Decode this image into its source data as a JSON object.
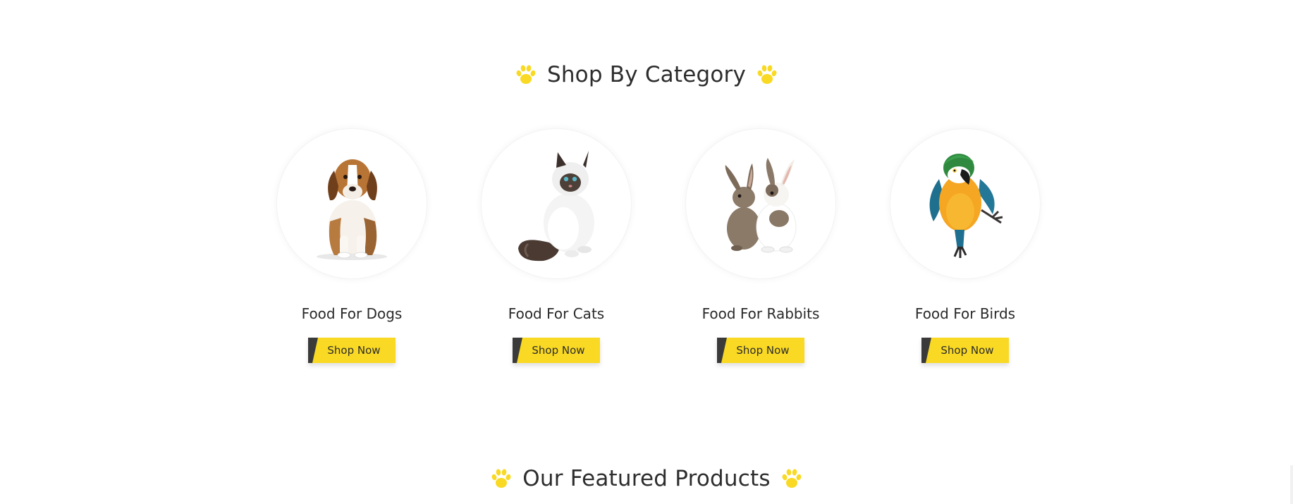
{
  "categories_section": {
    "title": "Shop By Category",
    "items": [
      {
        "label": "Food For Dogs",
        "button": "Shop Now",
        "image": "beagle-puppy"
      },
      {
        "label": "Food For Cats",
        "button": "Shop Now",
        "image": "white-fluffy-cat"
      },
      {
        "label": "Food For Rabbits",
        "button": "Shop Now",
        "image": "two-rabbits"
      },
      {
        "label": "Food For Birds",
        "button": "Shop Now",
        "image": "macaw-parrot"
      }
    ]
  },
  "featured_section": {
    "title": "Our Featured Products"
  },
  "icons": {
    "heading_decoration": "paw-icon"
  },
  "colors": {
    "accent": "#f9d923",
    "button_dark": "#3a3a3a",
    "heading_text": "#2d2d2d"
  }
}
